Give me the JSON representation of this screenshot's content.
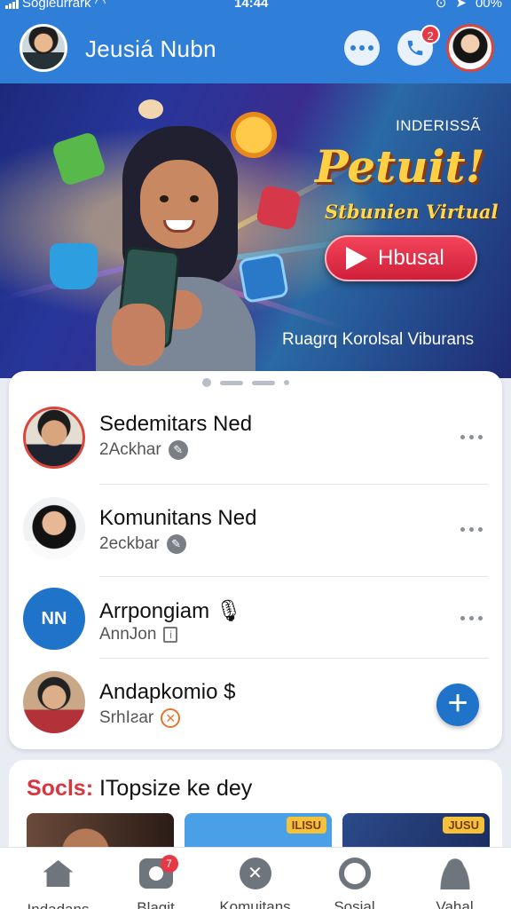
{
  "status_bar": {
    "carrier": "Sogleurrark",
    "time": "14:44",
    "battery": "00%"
  },
  "header": {
    "title": "Jeusiá Nubn",
    "call_badge": "2"
  },
  "banner": {
    "brand_small": "INDERISSÃ",
    "title": "Petuit!",
    "subtitle": "Stbunien Virtual",
    "cta_label": "Hbusal",
    "caption": "Ruagrq Korolsal Viburans"
  },
  "chats": [
    {
      "name": "Sedemitars Ned",
      "sub": "2Ackhar"
    },
    {
      "name": "Komunitans Ned",
      "sub": "2eckbar"
    },
    {
      "name": "Arrpongiam",
      "sub": "AnnJon",
      "avatar_text": "NN"
    },
    {
      "name": "Andapkomio $",
      "sub": "SrhIƨar"
    }
  ],
  "social": {
    "accent": "Socls:",
    "title": "ITopsize ke dey",
    "thumb_tag_2": "ILISU",
    "thumb_tag_3": "JUSU"
  },
  "bottom_nav": {
    "items": [
      "Indadans",
      "Blagit",
      "Komuitans",
      "Sosial",
      "Vahal"
    ],
    "badge": "7"
  },
  "colors": {
    "primary": "#2f7fd8",
    "accent_red": "#e53945",
    "cta_red": "#d01f3a",
    "banner_yellow": "#ffd043"
  }
}
